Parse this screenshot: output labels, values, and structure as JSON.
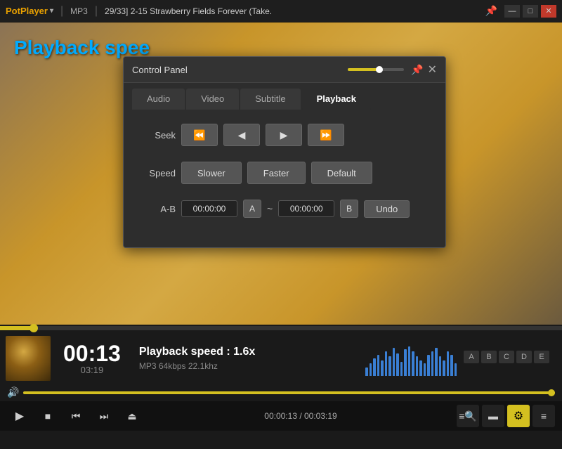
{
  "titlebar": {
    "logo": "PotPlayer",
    "format": "MP3",
    "title": "29/33] 2-15 Strawberry Fields Forever (Take.",
    "pin_label": "📌",
    "minimize_label": "—",
    "maximize_label": "□",
    "close_label": "✕"
  },
  "background_text": "Playback spee",
  "control_panel": {
    "title": "Control Panel",
    "pin": "📌",
    "close": "✕",
    "tabs": [
      "Audio",
      "Video",
      "Subtitle",
      "Playback"
    ],
    "active_tab": "Playback",
    "seek_label": "Seek",
    "seek_buttons": [
      "⏪",
      "◀",
      "▶",
      "⏩"
    ],
    "speed_label": "Speed",
    "speed_buttons": [
      "Slower",
      "Faster",
      "Default"
    ],
    "ab_label": "A-B",
    "ab_start": "00:00:00",
    "ab_end": "00:00:00",
    "ab_start_marker": "A",
    "ab_tilde": "~",
    "ab_end_marker": "B",
    "undo_label": "Undo"
  },
  "player": {
    "current_time": "00:13",
    "total_time": "03:19",
    "playback_speed_text": "Playback speed : 1.6x",
    "track_meta": "MP3   64kbps   22.1khz",
    "progress_percent": 6,
    "volume_percent": 100,
    "time_counter": "00:00:13 / 00:03:19",
    "spectrum_heights": [
      12,
      18,
      25,
      30,
      22,
      35,
      28,
      40,
      32,
      20,
      38,
      42,
      35,
      28,
      22,
      18,
      30,
      35,
      40,
      28,
      22,
      35,
      30,
      18
    ],
    "controls": {
      "play": "▶",
      "stop": "■",
      "prev": "⏮",
      "next": "⏭",
      "eject": "⏏",
      "playlist": "≡",
      "subtitles": "CC",
      "gear": "⚙",
      "menu": "≡"
    },
    "right_icons": [
      "A",
      "B",
      "C",
      "D",
      "E"
    ]
  }
}
